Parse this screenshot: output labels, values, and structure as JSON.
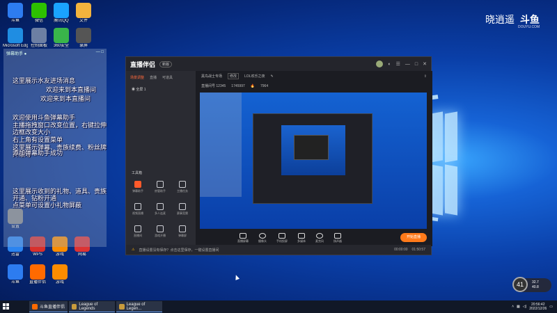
{
  "watermark": {
    "brand": "晓逍遥",
    "logo": "斗鱼",
    "site": "DOUYU.COM"
  },
  "desktop_icons": [
    {
      "label": "斗鱼",
      "color": "#2d7cf0",
      "icon": "bird-icon"
    },
    {
      "label": "微信",
      "color": "#2dc100",
      "icon": "wechat-icon"
    },
    {
      "label": "腾讯QQ",
      "color": "#1aa3ff",
      "icon": "qq-icon"
    },
    {
      "label": "Microsoft Edge",
      "color": "#1f8de2",
      "icon": "edge-icon"
    },
    {
      "label": "控制面板",
      "color": "#6d7fa3",
      "icon": "control-panel-icon"
    },
    {
      "label": "360安全",
      "color": "#39b54a",
      "icon": "shield-icon"
    },
    {
      "label": "WPS",
      "color": "#d9302c",
      "icon": "wps-icon"
    },
    {
      "label": "文件",
      "color": "#f3b33d",
      "icon": "folder-icon"
    },
    {
      "label": "迅雷",
      "color": "#2b84f0",
      "icon": "thunder-icon"
    },
    {
      "label": "网易",
      "color": "#d33",
      "icon": "netease-icon"
    },
    {
      "label": "设置",
      "color": "#888",
      "icon": "gear-icon"
    },
    {
      "label": "直播伴侣",
      "color": "#ff6a00",
      "icon": "live-icon"
    },
    {
      "label": "游戏",
      "color": "#fb8c00",
      "icon": "game-icon"
    },
    {
      "label": "录屏",
      "color": "#555",
      "icon": "record-icon"
    }
  ],
  "chat": {
    "header_left": "弹幕助手 ●",
    "header_right": "— □",
    "lines": [
      "这里展示水友进场消息",
      "欢迎来到本直播间",
      "欢迎来到本直播间",
      "欢迎使用斗鱼弹幕助手",
      "主播拖拽窗口改变位置，右键拉伸边框改变大小",
      "右上角有设置菜单",
      "这里展示弹幕、贵族续费、粉丝牌升级等",
      "添加弹幕助手成功",
      "这里展示收到的礼物、道具、贵族开通、钻粉开通",
      "点菜单可设置小礼物屏蔽"
    ]
  },
  "app": {
    "logo": "直播伴侣",
    "version_badge": "新版",
    "left_tabs": [
      "场景调整",
      "直播",
      "可道具"
    ],
    "scene_label": "全屏 1",
    "tools_title": "工具箱",
    "tools": [
      "弹幕助手",
      "房管助手",
      "主播任务",
      "视频直播",
      "多人连麦",
      "赛事竞猜",
      "直播间",
      "游戏开播",
      "弹幕屏"
    ],
    "room_title": "黑鸟战士专场",
    "room_tag": "修改",
    "category": "LOL欢乐之夜",
    "room_id": "直播间号 12345",
    "fans": "1745997",
    "heat": "7964",
    "bottom_tools": [
      "直播屏幕",
      "摄像头",
      "手机投屏",
      "多媒体",
      "麦克风",
      "扬声器"
    ],
    "start_button": "开始直播",
    "status_text": "直播设置没有保存？点击这里保存，一键设置直播间",
    "status_time_a": "00:00:00",
    "status_time_b": "01:50:57",
    "mic_value": "---",
    "speaker_value": "---"
  },
  "taskbar": {
    "apps": [
      {
        "label": "斗鱼直播伴侣",
        "color": "#ff6a00"
      },
      {
        "label": "League of Legends",
        "color": "#c89b3c"
      },
      {
        "label": "League of Legen...",
        "color": "#c89b3c"
      }
    ],
    "time": "20:56:42",
    "date": "2022/12/26"
  },
  "widget": {
    "value": "41",
    "unit": "%",
    "up": "32.7",
    "down": "40.8"
  }
}
